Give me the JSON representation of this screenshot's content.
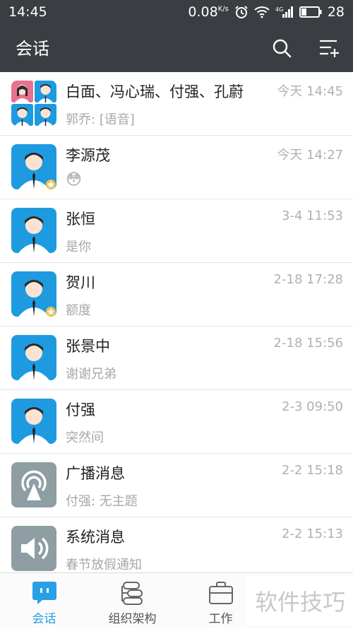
{
  "status_bar": {
    "time": "14:45",
    "speed": "0.08",
    "speed_unit": "K/s",
    "network": "4G",
    "battery": "28"
  },
  "header": {
    "title": "会话"
  },
  "conversations": [
    {
      "name": "白面、冯心瑞、付强、孔蔚",
      "time": "今天 14:45",
      "preview": "郭乔: [语音]",
      "avatar": "group-avatar"
    },
    {
      "name": "李源茂",
      "time": "今天 14:27",
      "preview": "",
      "preview_emoji": "😳",
      "avatar": "person-avatar",
      "star": true
    },
    {
      "name": "张恒",
      "time": "3-4 11:53",
      "preview": "是你",
      "avatar": "person-avatar"
    },
    {
      "name": "贺川",
      "time": "2-18 17:28",
      "preview": "额度",
      "avatar": "person-avatar",
      "star": true
    },
    {
      "name": "张景中",
      "time": "2-18 15:56",
      "preview": "谢谢兄弟",
      "avatar": "person-avatar"
    },
    {
      "name": "付强",
      "time": "2-3 09:50",
      "preview": "突然间",
      "avatar": "person-avatar"
    },
    {
      "name": "广播消息",
      "time": "2-2 15:18",
      "preview": "付强: 无主题",
      "avatar": "broadcast-icon"
    },
    {
      "name": "系统消息",
      "time": "2-2 15:13",
      "preview": "春节放假通知",
      "avatar": "speaker-icon"
    }
  ],
  "tabs": [
    {
      "label": "会话",
      "icon": "chat-icon",
      "active": true
    },
    {
      "label": "组织架构",
      "icon": "org-icon",
      "active": false
    },
    {
      "label": "工作",
      "icon": "briefcase-icon",
      "active": false
    }
  ],
  "watermark": "软件技巧",
  "colors": {
    "header": "#3a3d42",
    "accent": "#2a9fe4",
    "avatar_blue": "#1e9be0",
    "avatar_gray": "#8e9ea3"
  }
}
